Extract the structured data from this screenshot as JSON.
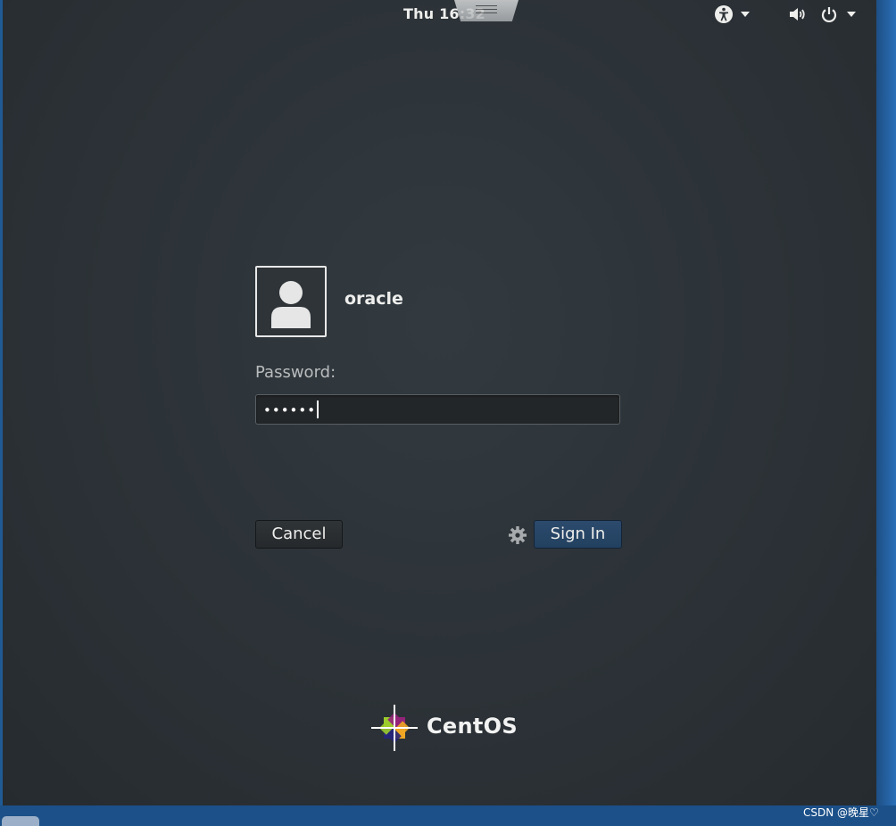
{
  "topbar": {
    "clock": "Thu 16:32",
    "icons": [
      "accessibility-icon",
      "volume-icon",
      "power-icon"
    ]
  },
  "login": {
    "username": "oracle",
    "password_label": "Password:",
    "password_value": "••••••",
    "cancel_label": "Cancel",
    "signin_label": "Sign In"
  },
  "branding": {
    "logo_text": "CentOS"
  },
  "watermark": "CSDN @晚星♡",
  "colors": {
    "background": "#2b3136",
    "signin_button": "#2c4a6c",
    "text": "#eeeeec"
  }
}
